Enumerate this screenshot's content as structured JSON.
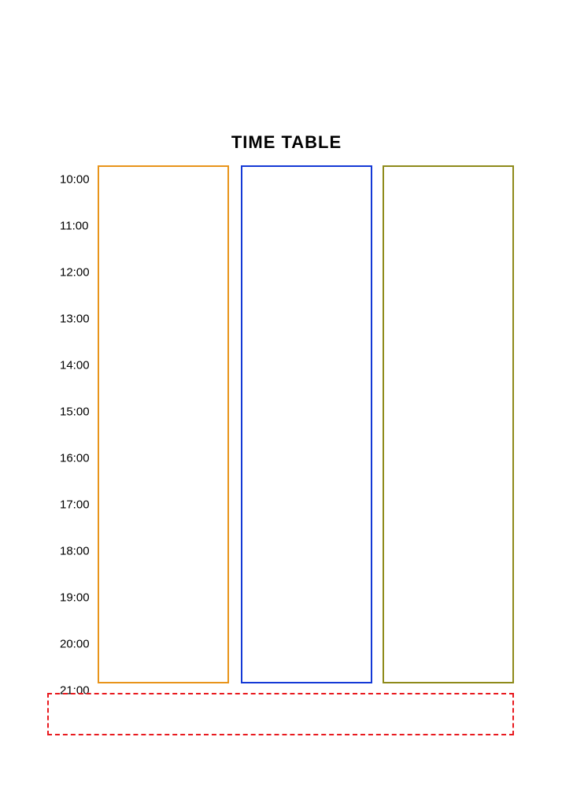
{
  "title": "TIME TABLE",
  "hours": [
    "10:00",
    "11:00",
    "12:00",
    "13:00",
    "14:00",
    "15:00",
    "16:00",
    "17:00",
    "18:00",
    "19:00",
    "20:00",
    "21:00"
  ],
  "columns": [
    {
      "color": "#e8941a"
    },
    {
      "color": "#1439d6"
    },
    {
      "color": "#8e8a1a"
    }
  ],
  "footer": {
    "color": "#e81a1f"
  }
}
